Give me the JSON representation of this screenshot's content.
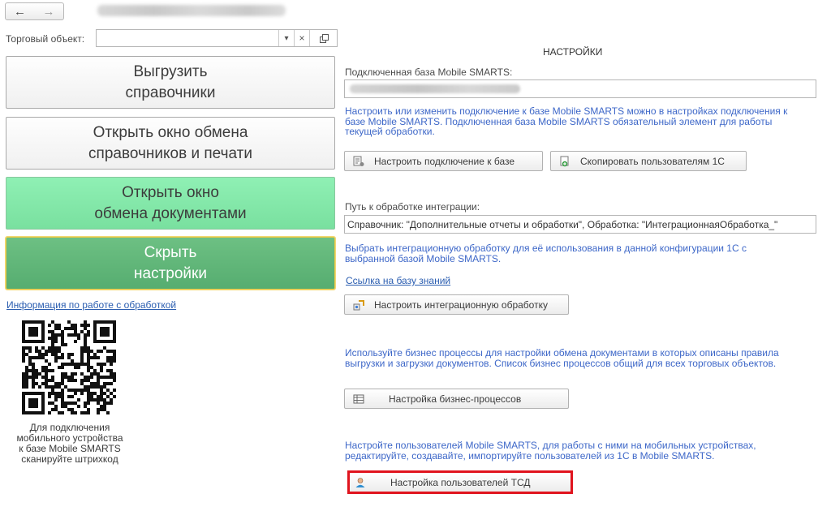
{
  "nav": {
    "back": "←",
    "forward": "→"
  },
  "trade_object": {
    "label": "Торговый объект:",
    "value": "",
    "dropdown_glyph": "▾",
    "clear_glyph": "×"
  },
  "left_buttons": {
    "export": [
      "Выгрузить",
      "справочники"
    ],
    "exchange": [
      "Открыть окно обмена",
      "справочников и печати"
    ],
    "documents": [
      "Открыть окно",
      "обмена документами"
    ],
    "hide": [
      "Скрыть",
      "настройки"
    ]
  },
  "info_link": "Информация по работе с обработкой",
  "qr_caption": [
    "Для подключения",
    "мобильного устройства",
    "к базе Mobile SMARTS",
    "сканируйте штрихкод"
  ],
  "settings": {
    "title": "НАСТРОЙКИ",
    "db_label": "Подключенная база Mobile SMARTS:",
    "db_hint": "Настроить или изменить подключение к базе Mobile SMARTS можно в настройках подключения к базе Mobile SMARTS. Подключенная база Mobile SMARTS обязательный элемент для работы текущей обработки.",
    "btn_connect": "Настроить подключение к базе",
    "btn_copy_users": "Скопировать пользователям 1С",
    "path_label": "Путь к обработке интеграции:",
    "path_value": "Справочник: \"Дополнительные отчеты и обработки\", Обработка: \"ИнтеграционнаяОбработка_\"",
    "path_hint": "Выбрать интеграционную обработку для её использования в данной конфигурации 1С с выбранной базой Mobile SMARTS.",
    "kb_link": "Ссылка на базу знаний",
    "btn_integration": "Настроить интеграционную обработку",
    "bp_hint": "Используйте бизнес процессы для настройки обмена документами в которых описаны правила выгрузки и загрузки документов. Список бизнес процессов общий для всех торговых объектов.",
    "btn_bp": "Настройка бизнес-процессов",
    "users_hint": "Настройте пользователей Mobile SMARTS, для работы с ними на мобильных устройствах, редактируйте, создавайте, импортируйте пользователей из 1С в Mobile SMARTS.",
    "btn_users": "Настройка пользователей ТСД"
  },
  "colors": {
    "hint_blue": "#3d67c8",
    "highlight_red": "#e0141e",
    "green_btn": "#7fe6a6",
    "dark_green_btn": "#5fb679"
  }
}
